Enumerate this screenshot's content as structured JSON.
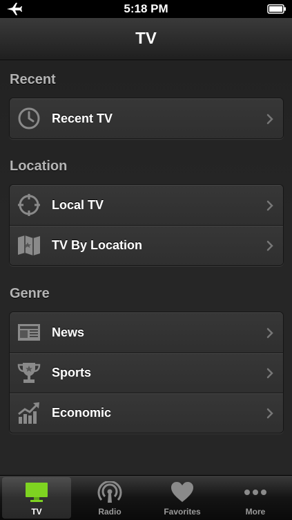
{
  "status": {
    "time": "5:18 PM"
  },
  "nav": {
    "title": "TV"
  },
  "sections": {
    "recent": {
      "header": "Recent",
      "items": [
        {
          "label": "Recent TV",
          "icon": "clock-icon"
        }
      ]
    },
    "location": {
      "header": "Location",
      "items": [
        {
          "label": "Local TV",
          "icon": "crosshair-icon"
        },
        {
          "label": "TV By Location",
          "icon": "map-icon"
        }
      ]
    },
    "genre": {
      "header": "Genre",
      "items": [
        {
          "label": "News",
          "icon": "newspaper-icon"
        },
        {
          "label": "Sports",
          "icon": "trophy-icon"
        },
        {
          "label": "Economic",
          "icon": "chart-icon"
        }
      ]
    }
  },
  "tabs": [
    {
      "label": "TV",
      "icon": "tv-icon",
      "selected": true
    },
    {
      "label": "Radio",
      "icon": "radio-icon",
      "selected": false
    },
    {
      "label": "Favorites",
      "icon": "heart-icon",
      "selected": false
    },
    {
      "label": "More",
      "icon": "more-icon",
      "selected": false
    }
  ],
  "colors": {
    "accent": "#7ed321",
    "background": "#262626",
    "text": "#ffffff",
    "section_header": "#b4b4b4"
  }
}
